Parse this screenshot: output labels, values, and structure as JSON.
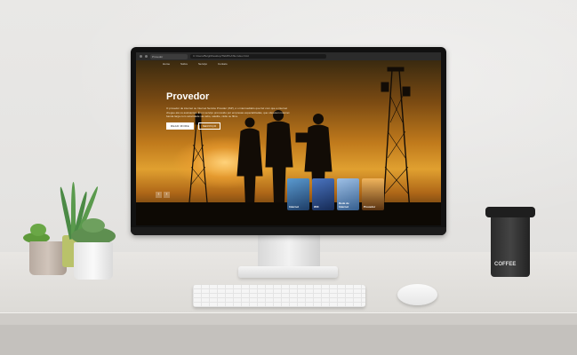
{
  "screen": {
    "browser_tab": "Provedor",
    "url": "C:/Users/Bulgil/Desktop/TEMPLATE-Index.html",
    "nav": [
      "Home",
      "Sobre",
      "Serviço",
      "Contato"
    ],
    "headline": "Provedor",
    "description": "O provedor de internet ou Internet Service Provider (ISP), é o intermediário que faz com que a internet chegue até os assinantes. É um serviço promovido por empresas especializadas, que oferecem internet banda larga com velocidade via cabo, satélite, rádio ou fibra.",
    "buttons": [
      "READ MORE",
      "SERVIÇO"
    ],
    "cards": [
      {
        "label": "Internet",
        "color": "#2d5d8c"
      },
      {
        "label": "Wifi",
        "color": "#274a8a"
      },
      {
        "label": "Rede de Internet",
        "color": "#5b86b5"
      },
      {
        "label": "Provedor",
        "color": "#c88a3b"
      }
    ]
  },
  "cup": {
    "text": "COFFEE"
  }
}
